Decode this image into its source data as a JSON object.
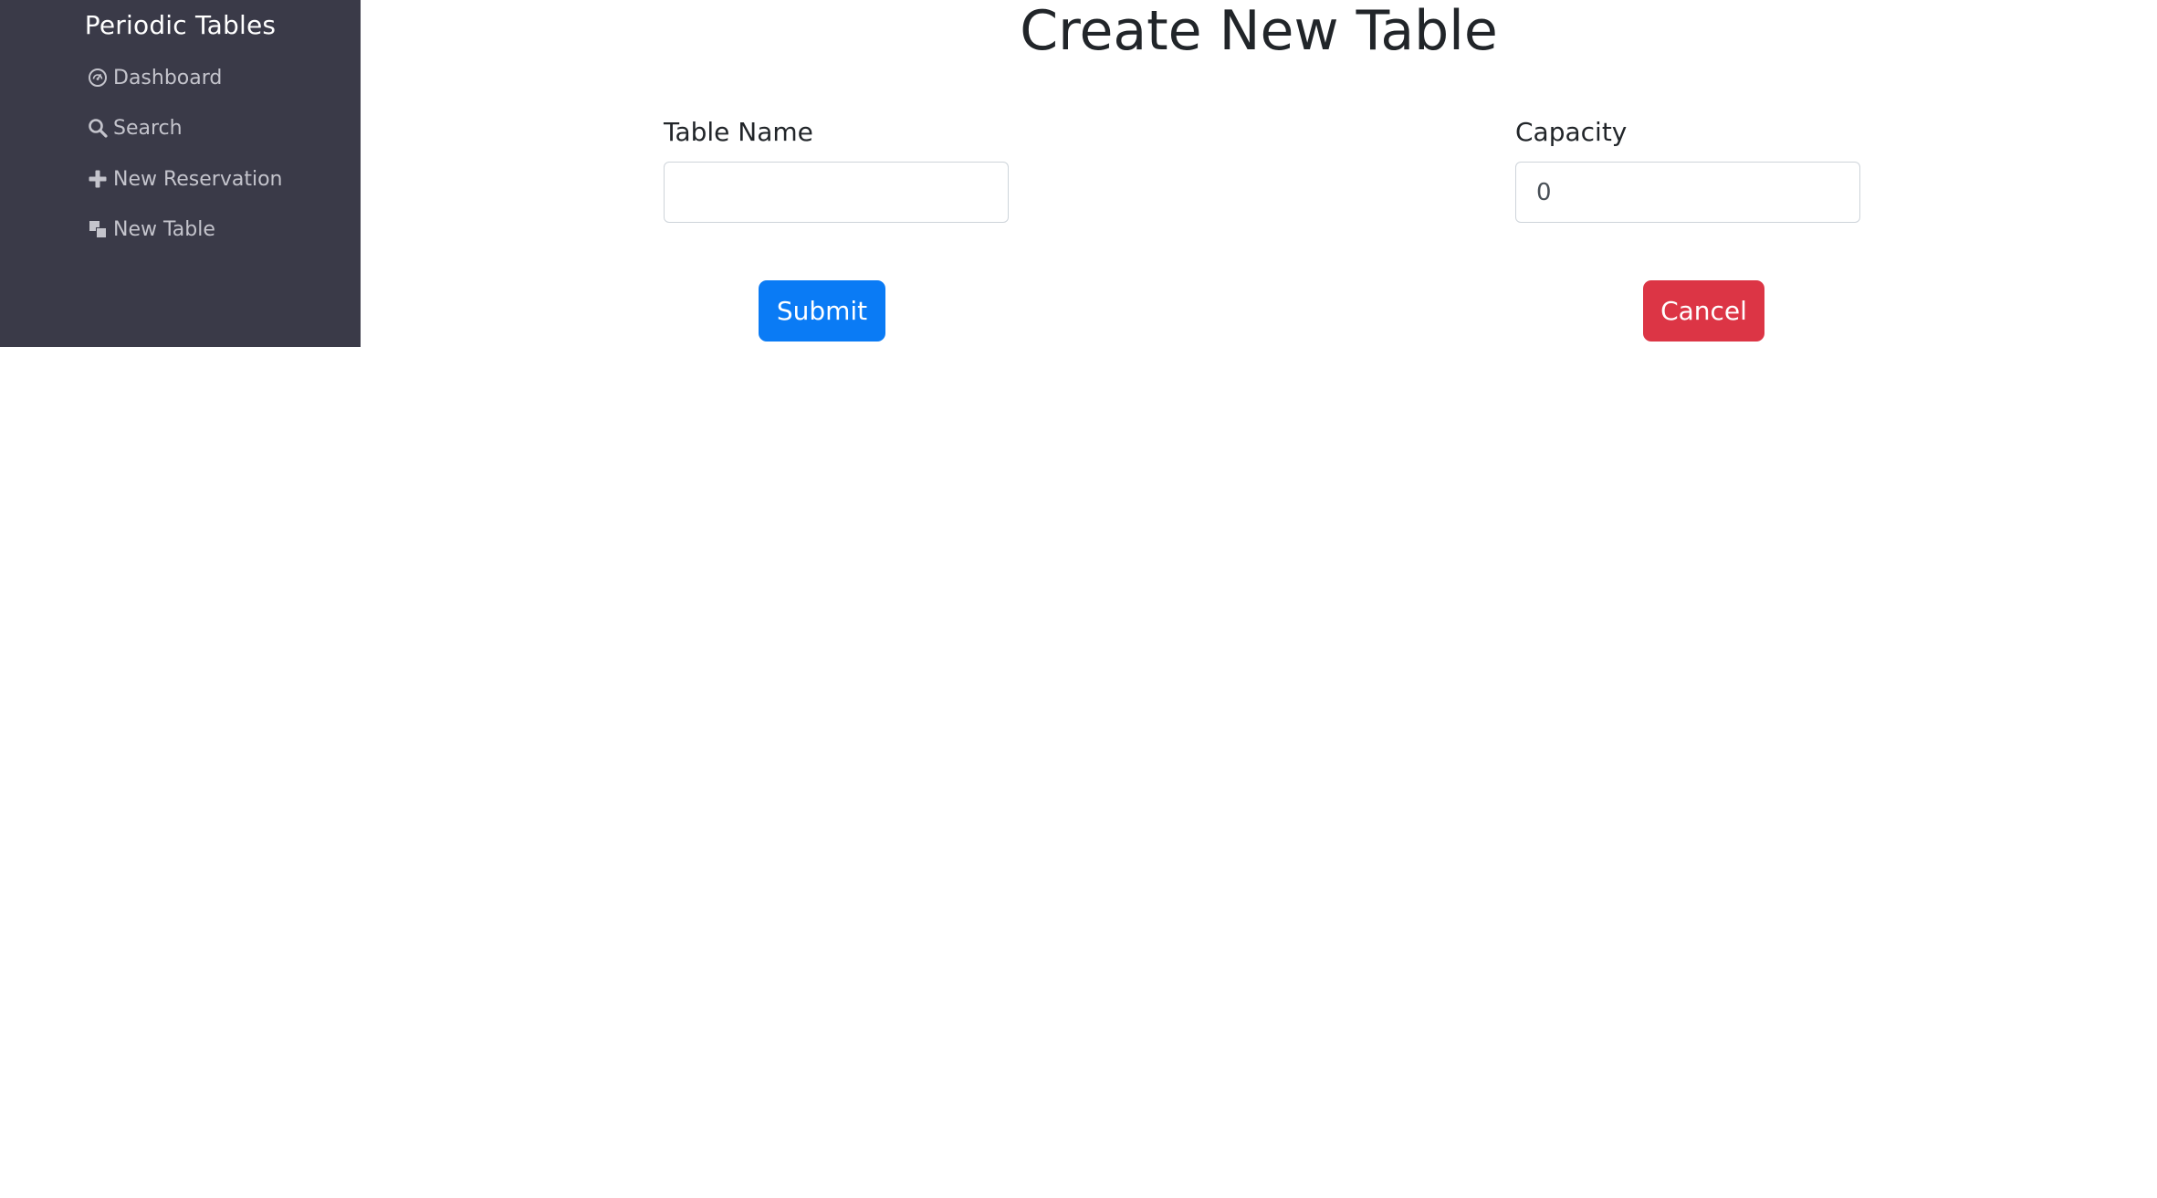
{
  "sidebar": {
    "brand": "Periodic Tables",
    "items": [
      {
        "label": "Dashboard",
        "icon": "dashboard-icon"
      },
      {
        "label": "Search",
        "icon": "search-icon"
      },
      {
        "label": "New Reservation",
        "icon": "plus-icon"
      },
      {
        "label": "New Table",
        "icon": "table-icon"
      }
    ],
    "background": "#3a3a48"
  },
  "main": {
    "title": "Create New Table",
    "form": {
      "table_name": {
        "label": "Table Name",
        "value": ""
      },
      "capacity": {
        "label": "Capacity",
        "value": "0"
      },
      "submit_label": "Submit",
      "cancel_label": "Cancel"
    }
  },
  "colors": {
    "submit": "#0a7bf5",
    "cancel": "#dc3545"
  }
}
